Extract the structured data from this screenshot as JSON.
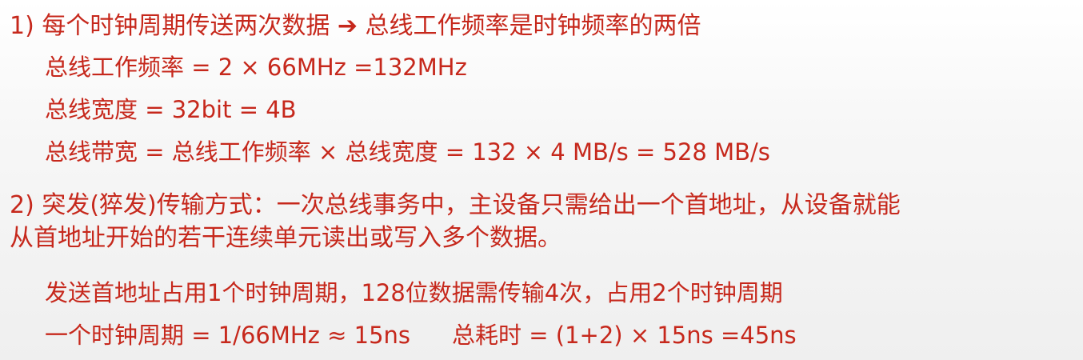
{
  "part1": {
    "heading": "1)  每个时钟周期传送两次数据 ➔ 总线工作频率是时钟频率的两倍",
    "bus_freq": "总线工作频率 = 2 × 66MHz =132MHz",
    "bus_width": "总线宽度 = 32bit = 4B",
    "bus_bandwidth": "总线带宽 = 总线工作频率 × 总线宽度 = 132 × 4 MB/s = 528 MB/s"
  },
  "part2": {
    "heading_line1": "2)  突发(猝发)传输方式：一次总线事务中，主设备只需给出一个首地址，从设备就能",
    "heading_line2": "从首地址开始的若干连续单元读出或写入多个数据。",
    "cycles": "发送首地址占用1个时钟周期，128位数据需传输4次，占用2个时钟周期",
    "period": "一个时钟周期 = 1/66MHz ≈ 15ns",
    "total": "总耗时 = (1+2) × 15ns =45ns"
  }
}
